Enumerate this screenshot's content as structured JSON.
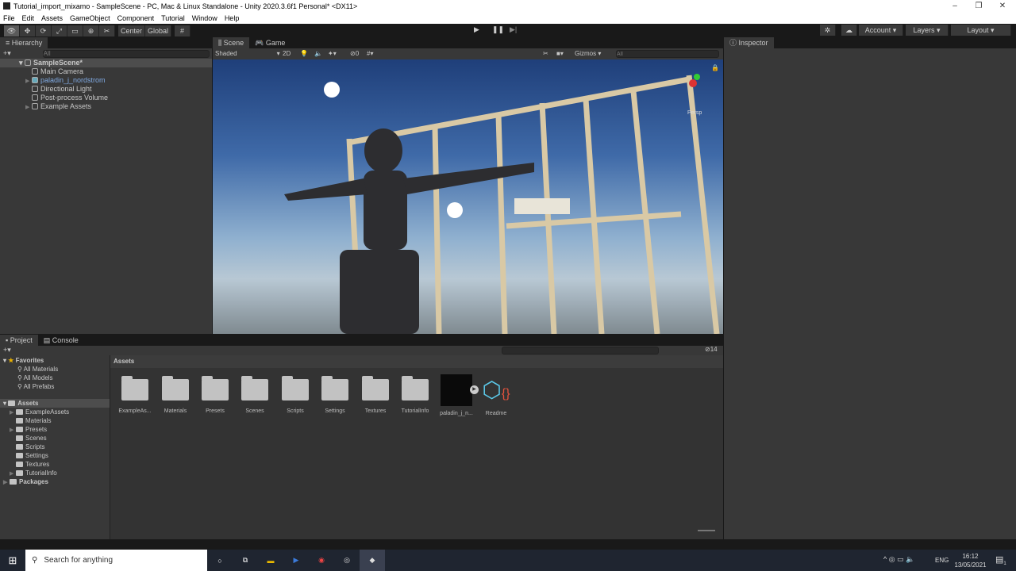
{
  "window": {
    "title": "Tutorial_import_mixamo - SampleScene - PC, Mac & Linux Standalone - Unity 2020.3.6f1 Personal* <DX11>"
  },
  "menu": [
    "File",
    "Edit",
    "Assets",
    "GameObject",
    "Component",
    "Tutorial",
    "Window",
    "Help"
  ],
  "toolbar": {
    "center": "Center",
    "global": "Global",
    "account": "Account",
    "layers": "Layers",
    "layout": "Layout"
  },
  "hierarchy": {
    "tab": "Hierarchy",
    "search_placeholder": "All",
    "scene": "SampleScene*",
    "items": [
      "Main Camera",
      "paladin_j_nordstrom",
      "Directional Light",
      "Post-process Volume",
      "Example Assets"
    ]
  },
  "scene": {
    "tabs": [
      "Scene",
      "Game"
    ],
    "shading": "Shaded",
    "mode2d": "2D",
    "hidden_count": "0",
    "gizmos": "Gizmos",
    "search_placeholder": "All",
    "persp": "Persp"
  },
  "inspector": {
    "tab": "Inspector"
  },
  "project": {
    "tabs": [
      "Project",
      "Console"
    ],
    "count": "14",
    "breadcrumb": "Assets",
    "favorites": {
      "label": "Favorites",
      "items": [
        "All Materials",
        "All Models",
        "All Prefabs"
      ]
    },
    "tree": {
      "label": "Assets",
      "items": [
        "ExampleAssets",
        "Materials",
        "Presets",
        "Scenes",
        "Scripts",
        "Settings",
        "Textures",
        "TutorialInfo"
      ],
      "packages": "Packages"
    },
    "assets": [
      "ExampleAs...",
      "Materials",
      "Presets",
      "Scenes",
      "Scripts",
      "Settings",
      "Textures",
      "TutorialInfo",
      "paladin_j_n...",
      "Readme"
    ]
  },
  "taskbar": {
    "search_placeholder": "Search for anything",
    "lang": "ENG",
    "time": "16:12",
    "date": "13/05/2021",
    "notifications": "1"
  }
}
